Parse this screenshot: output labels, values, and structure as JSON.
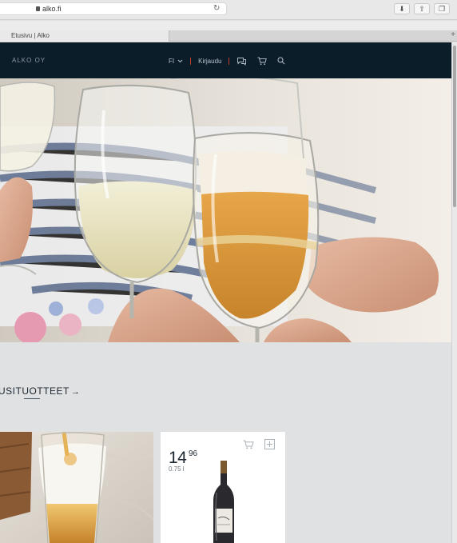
{
  "browser": {
    "url": "alko.fi",
    "tab_title": "Etusivu | Alko",
    "new_tab": "+",
    "reload_icon": "reload-icon",
    "download_icon": "download-icon",
    "share_icon": "share-icon",
    "tabs_icon": "tabs-icon"
  },
  "header": {
    "logo": "ALKO OY",
    "language": "FI",
    "login": "Kirjaudu",
    "icons": [
      "chat-icon",
      "cart-icon",
      "search-icon"
    ]
  },
  "section": {
    "title": "USITUOTTEET",
    "arrow": "→"
  },
  "product": {
    "price_euros": "14",
    "price_cents": "96",
    "volume": "0.75 l"
  },
  "colors": {
    "header_bg": "#0c1d2a",
    "accent_divider": "#c0392b",
    "page_bg": "#dfe1e2"
  }
}
